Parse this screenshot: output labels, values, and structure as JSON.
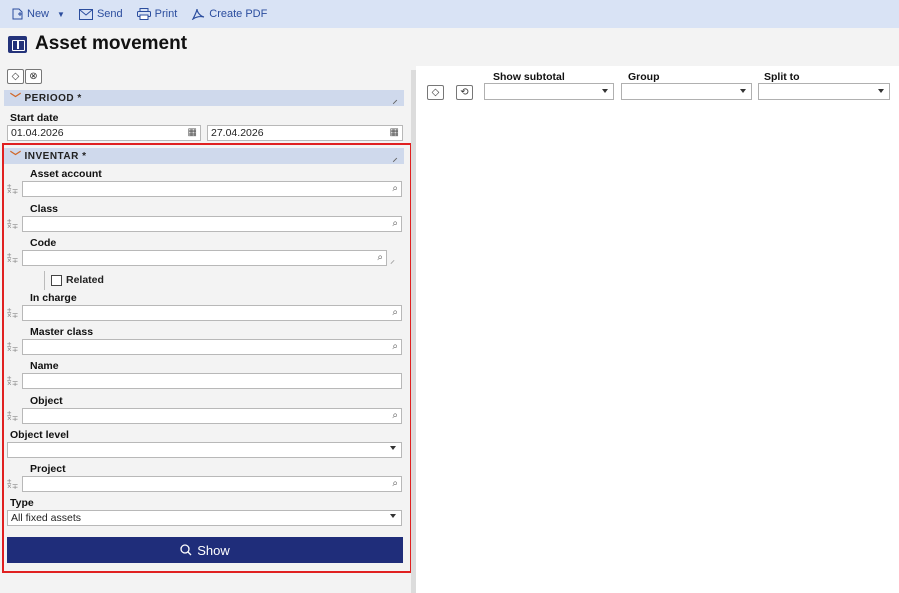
{
  "toolbar": {
    "new_label": "New",
    "send_label": "Send",
    "print_label": "Print",
    "create_pdf_label": "Create PDF"
  },
  "page_title": "Asset movement",
  "periood": {
    "header": "PERIOOD *",
    "start_date_label": "Start date",
    "start_date_value": "01.04.2026",
    "end_date_value": "27.04.2026"
  },
  "inventar": {
    "header": "INVENTAR *",
    "asset_account_label": "Asset account",
    "class_label": "Class",
    "code_label": "Code",
    "related_label": "Related",
    "in_charge_label": "In charge",
    "master_class_label": "Master class",
    "name_label": "Name",
    "object_label": "Object",
    "object_level_label": "Object level",
    "project_label": "Project",
    "type_label": "Type",
    "type_value": "All fixed assets"
  },
  "show_button_label": "Show",
  "right_panel": {
    "show_subtotal_label": "Show subtotal",
    "group_label": "Group",
    "split_to_label": "Split to"
  },
  "colors": {
    "accent": "#1f2d7a",
    "toolbar_bg": "#d9e3f5",
    "section_bg": "#cfd9ec",
    "highlight": "#e02020"
  }
}
